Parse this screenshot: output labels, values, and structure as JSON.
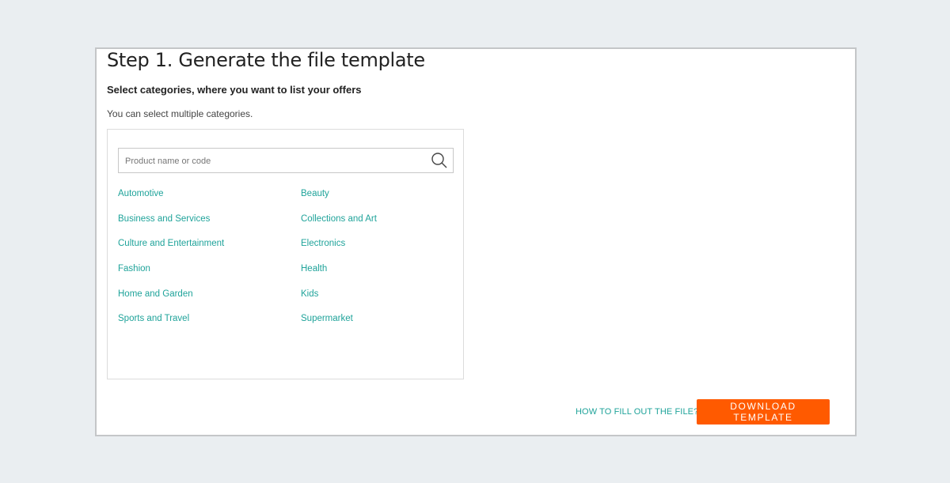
{
  "step": {
    "title": "Step 1. Generate the file template",
    "subtitle": "Select categories, where you want to list your offers",
    "hint": "You can select multiple categories."
  },
  "search": {
    "placeholder": "Product name or code",
    "value": "",
    "icon": "search-icon"
  },
  "categories": {
    "left": [
      "Automotive",
      "Business and Services",
      "Culture and Entertainment",
      "Fashion",
      "Home and Garden",
      "Sports and Travel"
    ],
    "right": [
      "Beauty",
      "Collections and Art",
      "Electronics",
      "Health",
      "Kids",
      "Supermarket"
    ]
  },
  "footer": {
    "help_link": "HOW TO FILL OUT THE FILE?",
    "download_button": "DOWNLOAD TEMPLATE"
  },
  "colors": {
    "accent": "#1fa39a",
    "button": "#ff5a00",
    "background": "#eaeef1"
  }
}
